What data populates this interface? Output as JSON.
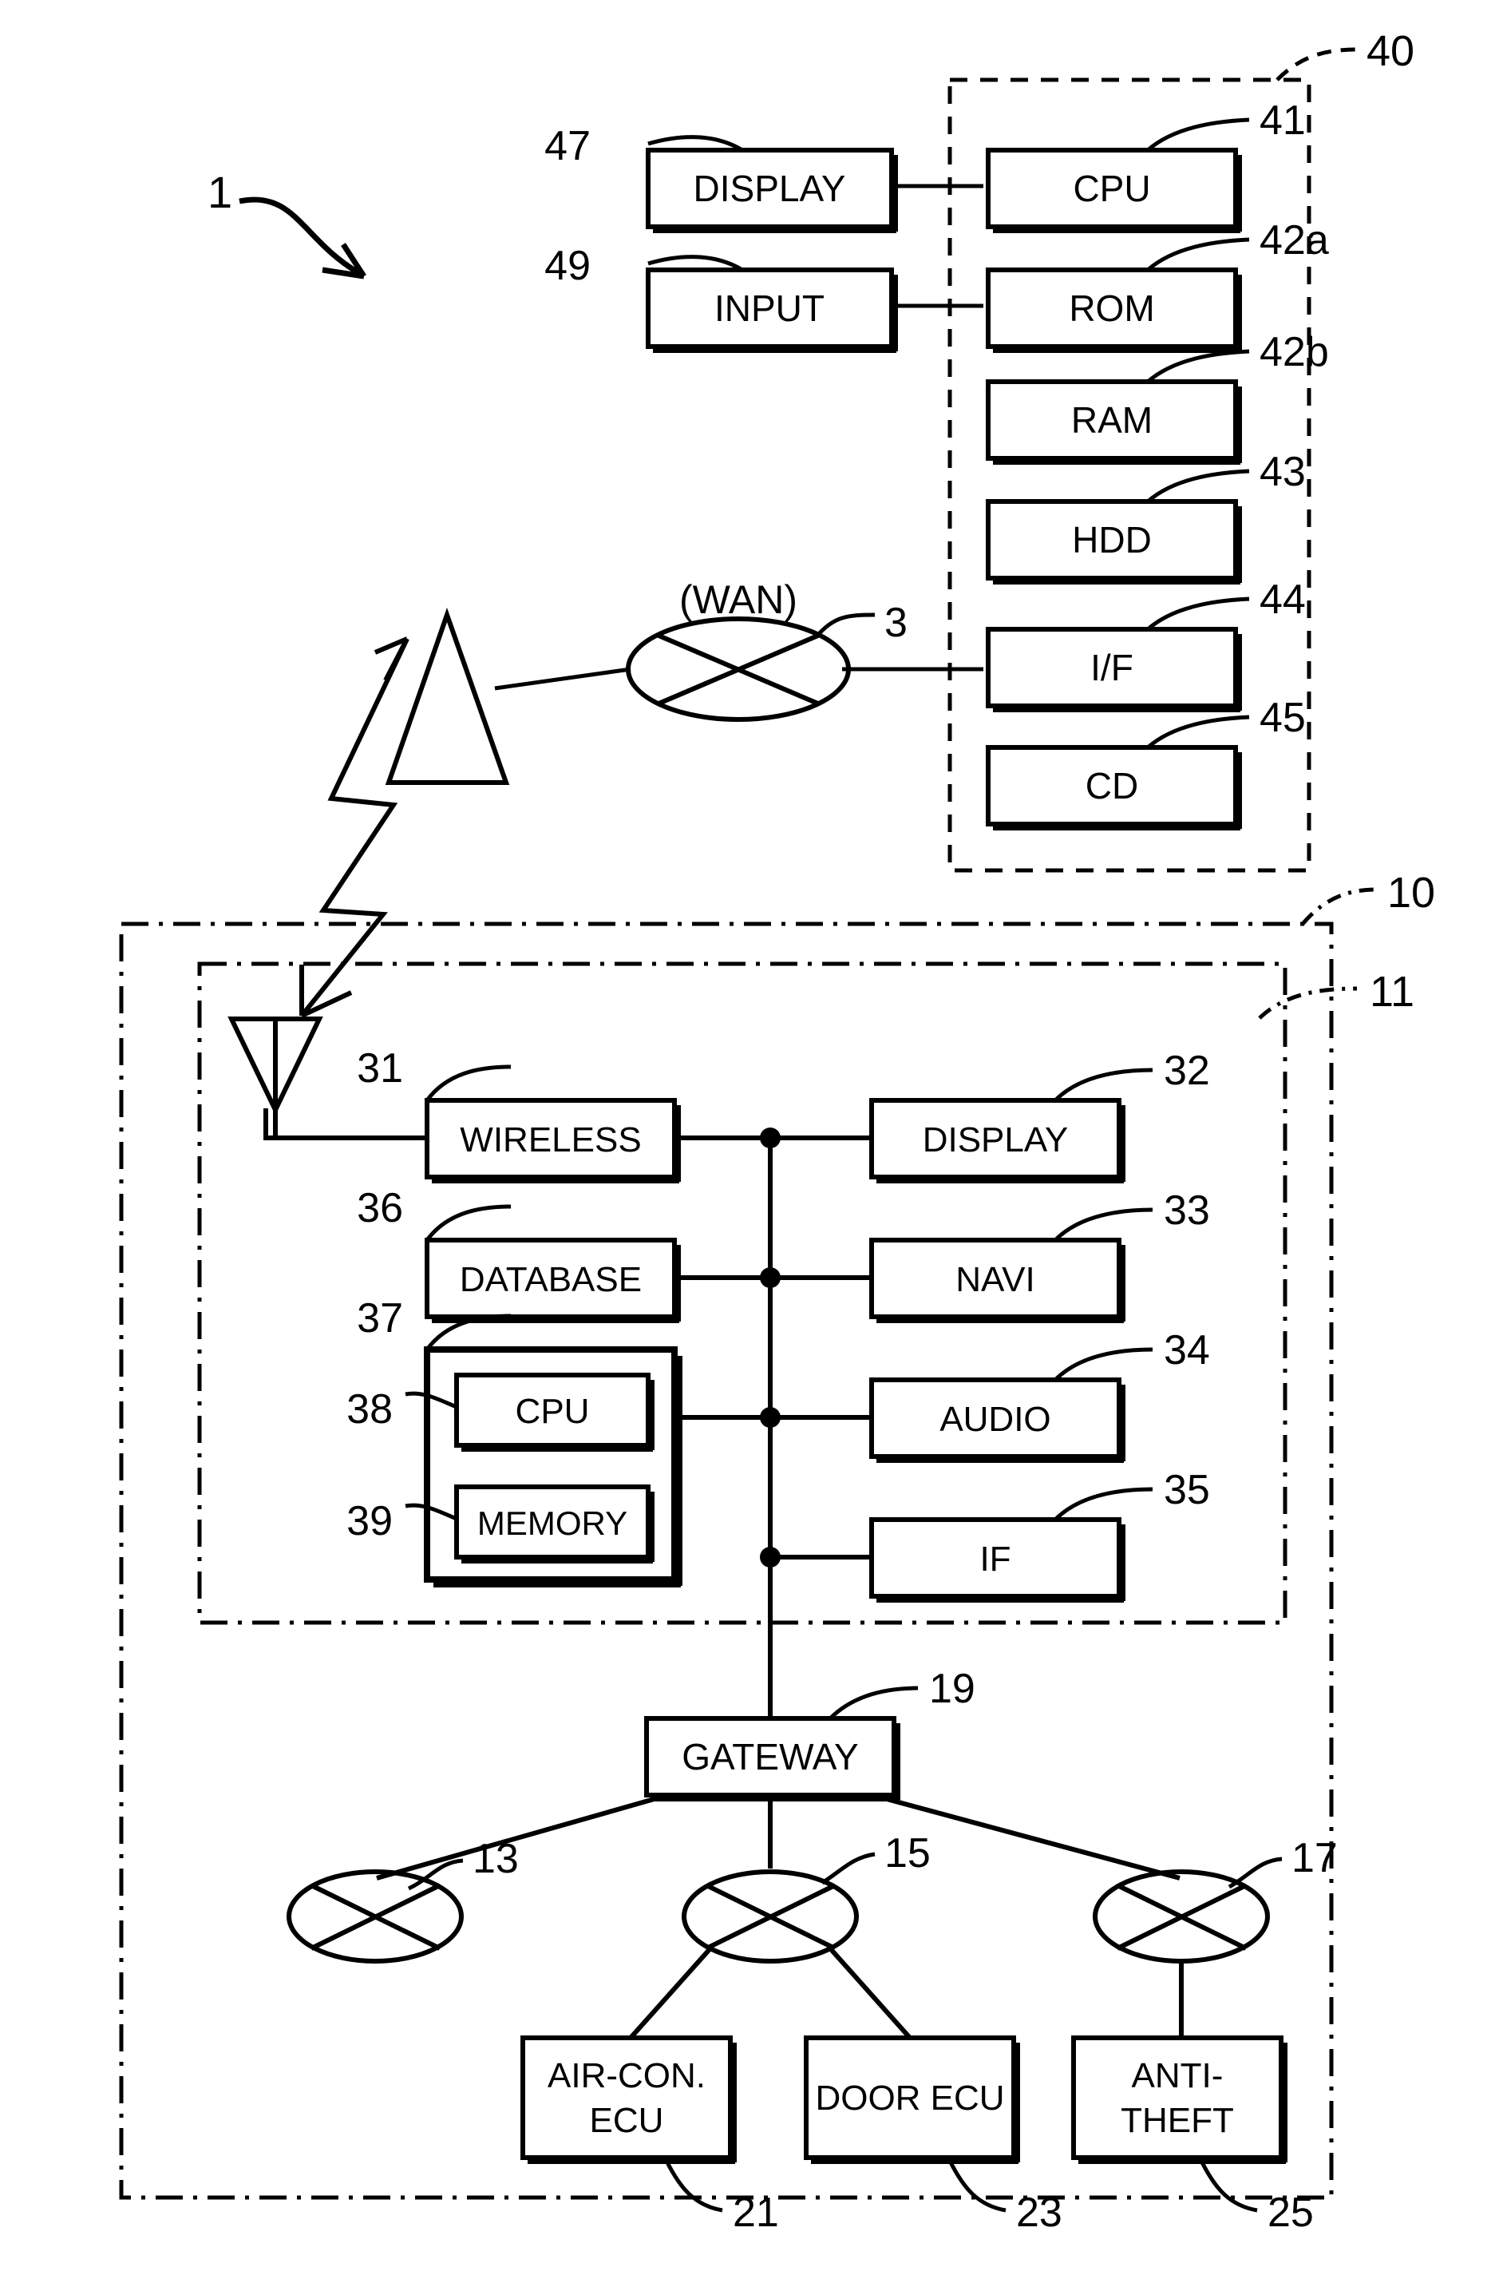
{
  "figure": {
    "type": "patent-block-diagram",
    "system_label": "1",
    "background": "#ffffff",
    "ink": "#000000"
  },
  "center_node": {
    "label": "3",
    "caption": "(WAN)",
    "icon": "crossed-ellipse-network-icon"
  },
  "base_station": {
    "antenna_icon": "transmit-antenna-icon"
  },
  "radio_link": {
    "icon": "lightning-bolt-bidirectional-arrow-icon"
  },
  "center_unit": {
    "ref": "40",
    "border_style": "dashed",
    "external_blocks": [
      {
        "ref": "47",
        "label": "DISPLAY"
      },
      {
        "ref": "49",
        "label": "INPUT"
      }
    ],
    "blocks": [
      {
        "ref": "41",
        "label": "CPU"
      },
      {
        "ref": "42a",
        "label": "ROM"
      },
      {
        "ref": "42b",
        "label": "RAM"
      },
      {
        "ref": "43",
        "label": "HDD"
      },
      {
        "ref": "44",
        "label": "I/F"
      },
      {
        "ref": "45",
        "label": "CD"
      }
    ]
  },
  "vehicle": {
    "ref": "10",
    "border_style": "dash-dot",
    "onboard_unit": {
      "ref": "11",
      "border_style": "dash-dot",
      "antenna_icon": "receive-antenna-icon",
      "left_blocks": [
        {
          "ref": "31",
          "label": "WIRELESS"
        },
        {
          "ref": "36",
          "label": "DATABASE"
        }
      ],
      "control_unit": {
        "ref": "37",
        "blocks": [
          {
            "ref": "38",
            "label": "CPU"
          },
          {
            "ref": "39",
            "label": "MEMORY"
          }
        ]
      },
      "right_blocks": [
        {
          "ref": "32",
          "label": "DISPLAY"
        },
        {
          "ref": "33",
          "label": "NAVI"
        },
        {
          "ref": "34",
          "label": "AUDIO"
        },
        {
          "ref": "35",
          "label": "IF"
        }
      ]
    },
    "gateway": {
      "ref": "19",
      "label": "GATEWAY"
    },
    "buses": [
      {
        "ref": "13",
        "icon": "crossed-ellipse-bus-icon"
      },
      {
        "ref": "15",
        "icon": "crossed-ellipse-bus-icon"
      },
      {
        "ref": "17",
        "icon": "crossed-ellipse-bus-icon"
      }
    ],
    "ecus": [
      {
        "ref": "21",
        "label_line1": "AIR-CON.",
        "label_line2": "ECU"
      },
      {
        "ref": "23",
        "label_line1": "DOOR ECU",
        "label_line2": ""
      },
      {
        "ref": "25",
        "label_line1": "ANTI-",
        "label_line2": "THEFT"
      }
    ]
  }
}
